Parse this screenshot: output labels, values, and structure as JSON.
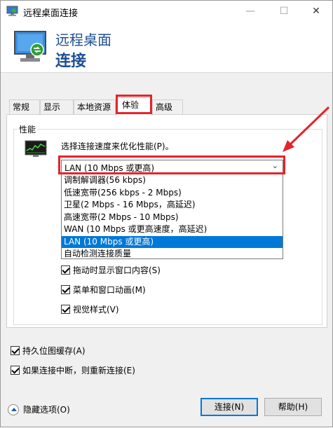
{
  "window": {
    "title": "远程桌面连接",
    "controls": {
      "minimize": "—",
      "maximize": "☐",
      "close": "✕"
    }
  },
  "header": {
    "title": "远程桌面",
    "subtitle": "连接"
  },
  "tabs": [
    {
      "label": "常规"
    },
    {
      "label": "显示"
    },
    {
      "label": "本地资源"
    },
    {
      "label": "体验"
    },
    {
      "label": "高级"
    }
  ],
  "performance": {
    "group_label": "性能",
    "prompt": "选择连接速度来优化性能(P)。",
    "select_value": "LAN (10 Mbps 或更高)",
    "options": [
      "调制解调器(56 kbps)",
      "低速宽带(256 kbps - 2 Mbps)",
      "卫星(2 Mbps - 16 Mbps，高延迟)",
      "高速宽带(2 Mbps - 10 Mbps)",
      "WAN (10 Mbps 或更高速度，高延迟)",
      "LAN (10 Mbps 或更高)",
      "自动检测连接质量"
    ],
    "checkboxes": [
      "拖动时显示窗口内容(S)",
      "菜单和窗口动画(M)",
      "视觉样式(V)"
    ]
  },
  "outer_checkboxes": [
    "持久位图缓存(A)",
    "如果连接中断，则重新连接(E)"
  ],
  "footer": {
    "toggle_label": "隐藏选项(O)",
    "connect_label": "连接(N)",
    "help_label": "帮助(H)"
  },
  "colors": {
    "accent": "#0078d7",
    "header_text": "#1d4f91",
    "annotation": "#e5242a"
  }
}
